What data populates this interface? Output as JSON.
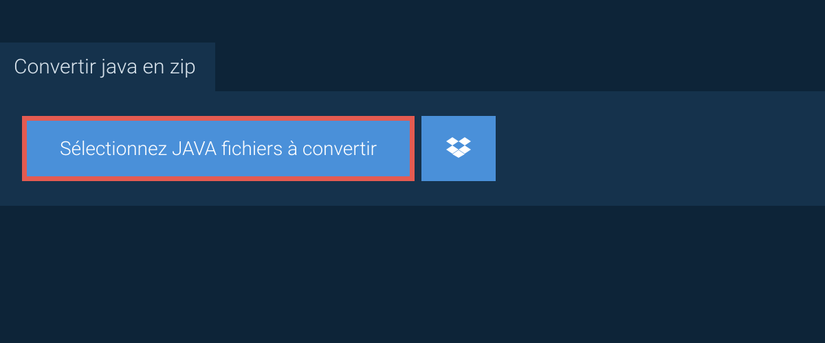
{
  "tab": {
    "title": "Convertir java en zip"
  },
  "actions": {
    "select_label": "Sélectionnez JAVA fichiers à convertir"
  },
  "colors": {
    "page_bg": "#0d2438",
    "panel_bg": "#15324c",
    "button_bg": "#4a90d9",
    "highlight_border": "#e45b51",
    "text_light": "#ffffff"
  }
}
